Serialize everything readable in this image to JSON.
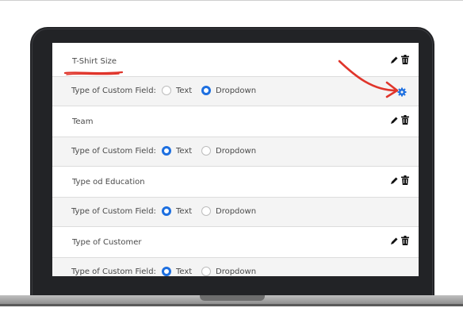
{
  "fields": [
    {
      "title": "T-Shirt Size",
      "type_label": "Type of Custom Field:",
      "selected": "dropdown",
      "has_settings": true
    },
    {
      "title": "Team",
      "type_label": "Type of Custom Field:",
      "selected": "text",
      "has_settings": false
    },
    {
      "title": "Type od Education",
      "type_label": "Type of Custom Field:",
      "selected": "text",
      "has_settings": false
    },
    {
      "title": "Type of Customer",
      "type_label": "Type of Custom Field:",
      "selected": "text",
      "has_settings": false
    }
  ],
  "options": {
    "text": "Text",
    "dropdown": "Dropdown"
  },
  "icons": {
    "edit": "pencil-icon",
    "delete": "trash-icon",
    "settings": "gear-icon"
  },
  "colors": {
    "accent": "#1d6fe0",
    "annotation": "#e0352b",
    "row_alt_bg": "#f4f4f4",
    "laptop_body": "#222326"
  }
}
